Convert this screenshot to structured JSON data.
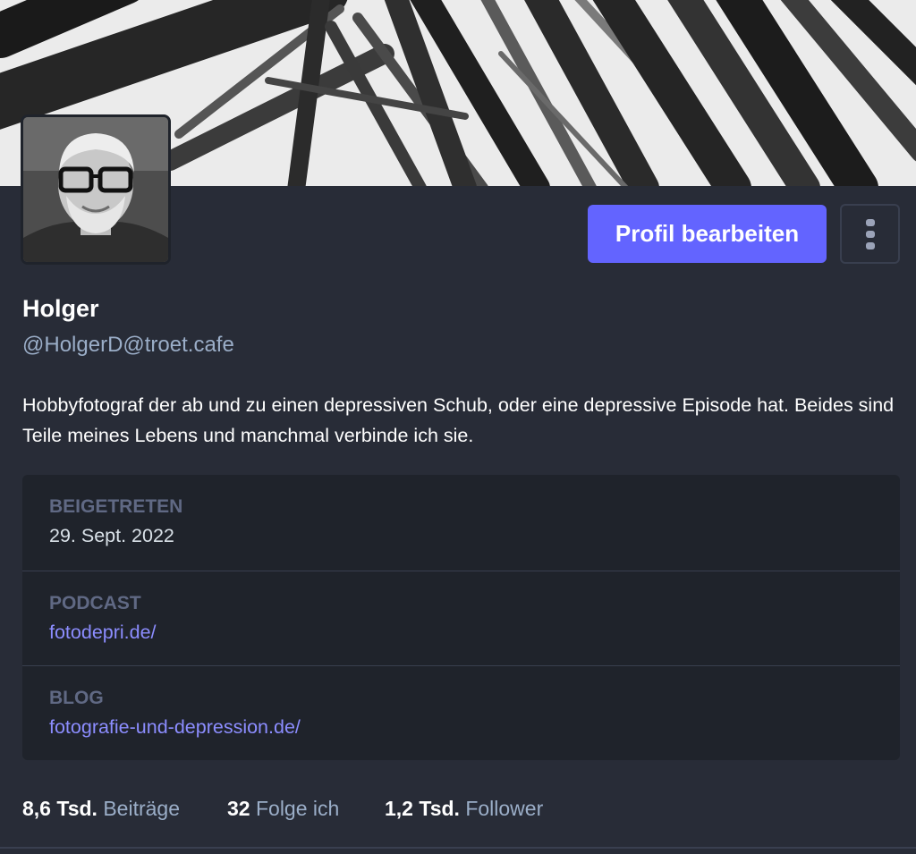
{
  "profile": {
    "display_name": "Holger",
    "handle": "@HolgerD@troet.cafe",
    "bio": "Hobbyfotograf der ab und zu einen depressiven Schub, oder eine depressive Episode hat. Beides sind Teile meines Lebens und manchmal verbinde ich sie.",
    "header_image": "monochrome-palm-leaves-photo",
    "avatar_image": "portrait-man-with-glasses-and-beard"
  },
  "actions": {
    "edit_label": "Profil bearbeiten",
    "more_icon": "vertical-ellipsis-icon"
  },
  "fields": [
    {
      "label": "BEIGETRETEN",
      "value": "29. Sept. 2022"
    },
    {
      "label": "PODCAST",
      "value": "fotodepri.de/"
    },
    {
      "label": "BLOG",
      "value": "fotografie-und-depression.de/"
    }
  ],
  "stats": [
    {
      "count": "8,6 Tsd.",
      "label": "Beiträge"
    },
    {
      "count": "32",
      "label": "Folge ich"
    },
    {
      "count": "1,2 Tsd.",
      "label": "Follower"
    }
  ],
  "colors": {
    "background": "#282c37",
    "accent": "#6364ff",
    "link": "#8c8dff",
    "secondary_text": "#9baec8",
    "field_label": "#606984"
  }
}
